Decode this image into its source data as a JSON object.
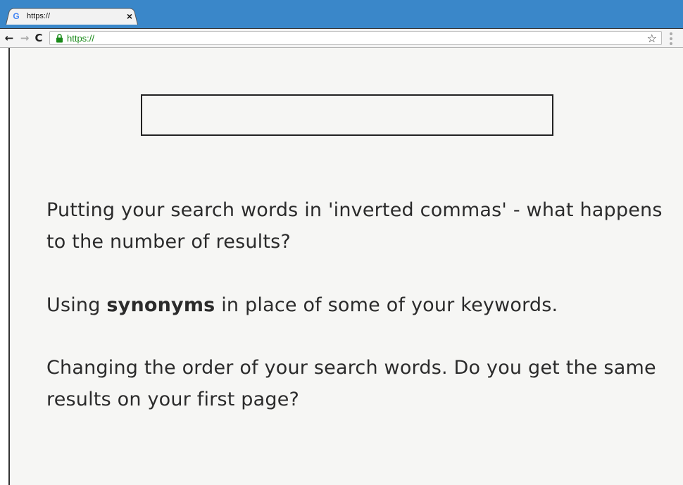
{
  "browser": {
    "tab_title": "https://",
    "tab_close": "×",
    "url": "https://",
    "nav": {
      "back": "←",
      "forward": "→",
      "reload": "C"
    },
    "bookmark_star": "☆"
  },
  "page": {
    "title_box_text": "",
    "paragraphs": {
      "p1": "Putting your search words in 'inverted commas' - what happens to the number of results?",
      "p2_pre": "Using ",
      "p2_bold": "synonyms",
      "p2_post": " in place of some of your keywords.",
      "p3": "Changing the order of your search words. Do you get the same results on your first page?"
    }
  },
  "icons": {
    "tab_favicon": "google-g-icon",
    "lock": "lock-icon",
    "star": "star-icon",
    "menu": "menu-icon"
  },
  "colors": {
    "tabstrip": "#3a87c9",
    "url_secure": "#1a8a1a",
    "page_bg": "#f6f6f4"
  }
}
